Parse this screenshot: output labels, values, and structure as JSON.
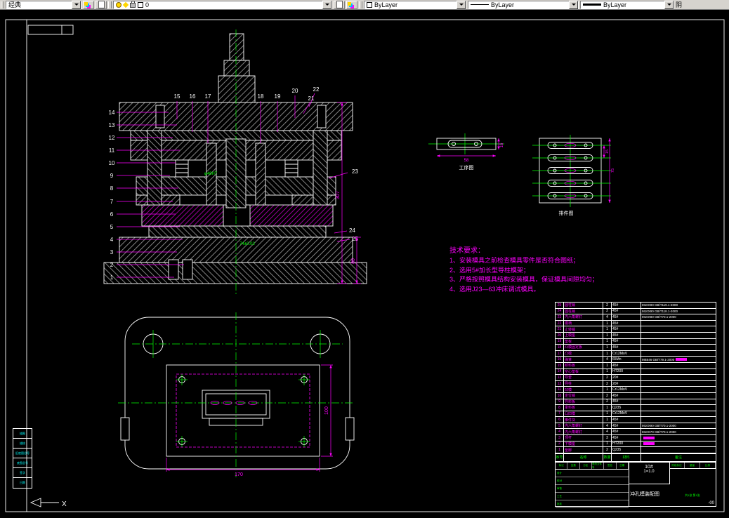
{
  "toolbar": {
    "workspace_label": "经典",
    "layer_value": "0",
    "color_value": "ByLayer",
    "linetype_value": "ByLayer",
    "lineweight_value": "ByLayer",
    "clipped_label": "阴"
  },
  "drawing": {
    "part_numbers": {
      "left": [
        "14",
        "13",
        "12",
        "11",
        "10",
        "9",
        "8",
        "7",
        "6",
        "5",
        "4",
        "3",
        "2",
        "1"
      ],
      "top": [
        "15",
        "16",
        "17",
        "18",
        "19",
        "20",
        "21",
        "22"
      ],
      "right": [
        "23",
        "24",
        "25"
      ]
    },
    "dimensions": {
      "section_height": "307",
      "base_height": "80",
      "bore_upper": "φ48H7",
      "bore_lower": "74±0.02",
      "plan_width": "170",
      "plan_height": "100",
      "process_width": "58",
      "process_height": "16",
      "strip_length": "75",
      "strip_pitch": "15"
    },
    "view_labels": {
      "process": "工序图",
      "strip": "排件图"
    },
    "ucs_axis": "X"
  },
  "tech_requirements": {
    "title": "技术要求：",
    "items": [
      "1、安装模具之前检查模具零件是否符合图纸；",
      "2、选用5#加长型导柱模架；",
      "3、严格按照模具结构安装模具，保证模具间隙均匀；",
      "4、选用J23—63冲床调试模具。"
    ]
  },
  "bom": {
    "headers": [
      "序号",
      "名称",
      "数量",
      "材料",
      "备注"
    ],
    "rows": [
      {
        "no": "25",
        "name": "圆柱销",
        "qty": "2",
        "material": "45#",
        "standard": "M10X90 GB/T119.1-2000"
      },
      {
        "no": "24",
        "name": "圆柱销",
        "qty": "2",
        "material": "45#",
        "standard": "M10X90 GB/T118.1-2000"
      },
      {
        "no": "23",
        "name": "内六角螺钉",
        "qty": "4",
        "material": "45#",
        "standard": "M10X80 GB/T70.1-2000"
      },
      {
        "no": "22",
        "name": "模柄",
        "qty": "1",
        "material": "45#",
        "standard": ""
      },
      {
        "no": "21",
        "name": "止转销",
        "qty": "1",
        "material": "45#",
        "standard": ""
      },
      {
        "no": "20",
        "name": "上模座",
        "qty": "1",
        "material": "45#",
        "standard": ""
      },
      {
        "no": "19",
        "name": "垫板",
        "qty": "1",
        "material": "45#",
        "standard": ""
      },
      {
        "no": "18",
        "name": "凸模固定板",
        "qty": "1",
        "material": "45#",
        "standard": ""
      },
      {
        "no": "17",
        "name": "凸模",
        "qty": "1",
        "material": "Cr12MoV",
        "standard": ""
      },
      {
        "no": "16",
        "name": "弹簧",
        "qty": "4",
        "material": "65Mn",
        "standard": "MB546 GB/T79.1-2000",
        "_hl": true
      },
      {
        "no": "15",
        "name": "卸料板",
        "qty": "1",
        "material": "45#",
        "standard": ""
      },
      {
        "no": "14",
        "name": "空心垫板",
        "qty": "1",
        "material": "HT200",
        "standard": ""
      },
      {
        "no": "13",
        "name": "导套",
        "qty": "2",
        "material": "20#",
        "standard": ""
      },
      {
        "no": "12",
        "name": "导柱",
        "qty": "2",
        "material": "20#",
        "standard": ""
      },
      {
        "no": "11",
        "name": "凹模",
        "qty": "1",
        "material": "Cr12MoV",
        "standard": ""
      },
      {
        "no": "10",
        "name": "定位销",
        "qty": "2",
        "material": "45#",
        "standard": ""
      },
      {
        "no": "9",
        "name": "导料板",
        "qty": "2",
        "material": "45#",
        "standard": ""
      },
      {
        "no": "8",
        "name": "承料板",
        "qty": "1",
        "material": "Q235",
        "standard": ""
      },
      {
        "no": "7",
        "name": "凸凹模",
        "qty": "1",
        "material": "Cr12MoV",
        "standard": ""
      },
      {
        "no": "6",
        "name": "推件块",
        "qty": "1",
        "material": "45#",
        "standard": ""
      },
      {
        "no": "5",
        "name": "内六角螺钉",
        "qty": "4",
        "material": "45#",
        "standard": "M10X90 GB/T70.1-2000"
      },
      {
        "no": "4",
        "name": "内六角螺钉",
        "qty": "4",
        "material": "45#",
        "standard": "M10X70 GB/T70.1-2000"
      },
      {
        "no": "3",
        "name": "顶杆",
        "qty": "3",
        "material": "45#",
        "standard": "",
        "_hl": true
      },
      {
        "no": "2",
        "name": "下模座",
        "qty": "1",
        "material": "HT200",
        "standard": "",
        "_hl": true
      },
      {
        "no": "1",
        "name": "垫脚",
        "qty": "2",
        "material": "Q235",
        "standard": ""
      }
    ]
  },
  "title_block": {
    "material": "10#",
    "scale": "1=1.0",
    "title": "冲孔模装配图",
    "sheet_no": "-00",
    "sig_header": [
      "标记",
      "处数",
      "分区",
      "更改文件号",
      "签名",
      "日期"
    ],
    "roles": [
      "设计",
      "校对",
      "审核",
      "工艺",
      "批准"
    ],
    "right_header": [
      "阶段标记",
      "重量",
      "比例"
    ],
    "pages": "共1张 第1张"
  },
  "side_table": {
    "rows": [
      "描图",
      "描校",
      "旧底图总号",
      "底图总号",
      "签字",
      "日期"
    ]
  }
}
